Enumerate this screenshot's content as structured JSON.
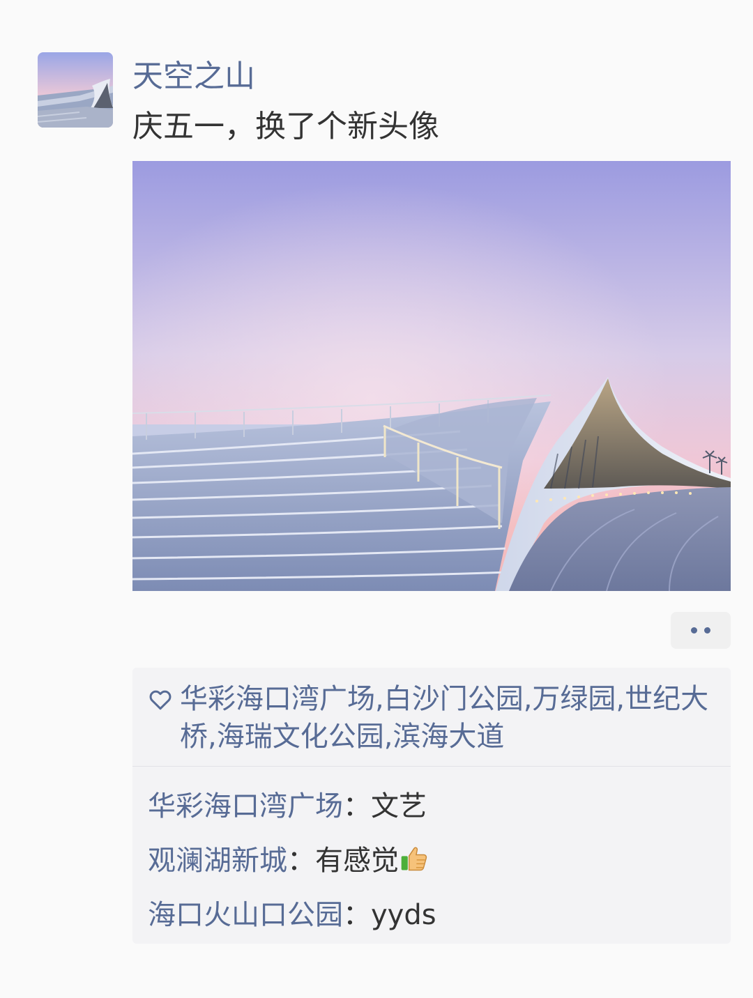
{
  "post": {
    "author_name": "天空之山",
    "text": "庆五一，换了个新头像"
  },
  "likes": {
    "names": "华彩海口湾广场,白沙门公园,万绿园,世纪大桥,海瑞文化公园,滨海大道"
  },
  "comments": [
    {
      "author": "华彩海口湾广场",
      "separator": "：",
      "text": "文艺"
    },
    {
      "author": "观澜湖新城",
      "separator": "：",
      "text": "有感觉",
      "emoji": "thumbs-up-icon"
    },
    {
      "author": "海口火山口公园",
      "separator": "：",
      "text": "yyds"
    }
  ],
  "colors": {
    "name_link": "#576b95",
    "body_text": "#333333",
    "background": "#fafafa",
    "panel": "#f3f3f5"
  }
}
